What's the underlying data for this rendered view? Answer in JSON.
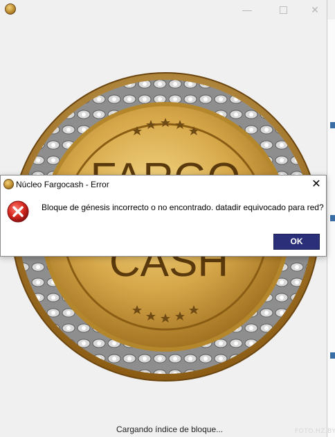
{
  "splash": {
    "status_text": "Cargando índice de bloque...",
    "coin_top_text": "FARGO",
    "coin_bottom_text": "CASH",
    "window_controls": {
      "minimize": "—",
      "maximize": "",
      "close": "✕"
    }
  },
  "dialog": {
    "title": "Núcleo Fargocash - Error",
    "message": "Bloque de génesis incorrecto o no encontrado. datadir equivocado para red?",
    "ok_label": "OK",
    "close_glyph": "✕",
    "icon": "error-icon"
  },
  "watermark": "FOTO.HZ.BY",
  "colors": {
    "ok_button": "#2b2f7a",
    "coin_gold": "#c9952f",
    "error_red": "#d12a2a"
  }
}
